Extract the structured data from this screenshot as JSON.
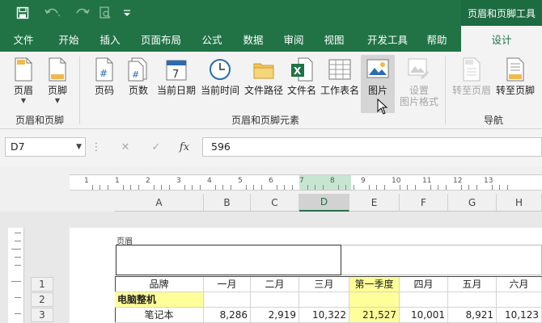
{
  "qat": {
    "save_icon": "save-icon",
    "undo_icon": "undo-icon",
    "redo_icon": "redo-icon",
    "preview_icon": "print-preview-icon",
    "customize_icon": "customize-qat-icon"
  },
  "context_tab_title": "页眉和页脚工具",
  "tabs": [
    {
      "label": "文件"
    },
    {
      "label": "开始"
    },
    {
      "label": "插入"
    },
    {
      "label": "页面布局"
    },
    {
      "label": "公式"
    },
    {
      "label": "数据"
    },
    {
      "label": "审阅"
    },
    {
      "label": "视图"
    },
    {
      "label": "开发工具"
    },
    {
      "label": "帮助"
    },
    {
      "label": "设计"
    }
  ],
  "ribbon": {
    "buttons": [
      {
        "label": "页眉",
        "icon": "header-icon"
      },
      {
        "label": "页脚",
        "icon": "footer-icon"
      },
      {
        "label": "页码",
        "icon": "page-number-icon"
      },
      {
        "label": "页数",
        "icon": "page-count-icon"
      },
      {
        "label": "当前日期",
        "icon": "calendar-icon"
      },
      {
        "label": "当前时间",
        "icon": "clock-icon"
      },
      {
        "label": "文件路径",
        "icon": "folder-icon"
      },
      {
        "label": "文件名",
        "icon": "excel-file-icon"
      },
      {
        "label": "工作表名",
        "icon": "sheet-icon"
      },
      {
        "label": "图片",
        "icon": "picture-icon"
      },
      {
        "label": "设置\n图片格式",
        "icon": "format-picture-icon"
      },
      {
        "label": "转至页眉",
        "icon": "goto-header-icon"
      },
      {
        "label": "转至页脚",
        "icon": "goto-footer-icon"
      }
    ],
    "groups": [
      {
        "label": "页眉和页脚"
      },
      {
        "label": "页眉和页脚元素"
      },
      {
        "label": "导航"
      }
    ]
  },
  "formula_bar": {
    "name_box": "D7",
    "cancel_icon": "cancel-icon",
    "enter_icon": "check-icon",
    "fx_label": "fx",
    "value": "596"
  },
  "ruler": {
    "numbers": [
      "1",
      "1",
      "2",
      "3",
      "4",
      "5",
      "6",
      "7",
      "8",
      "9",
      "10",
      "11",
      "12",
      "13"
    ]
  },
  "columns": [
    "A",
    "B",
    "C",
    "D",
    "E",
    "F",
    "G",
    "H"
  ],
  "active_column": "D",
  "page": {
    "header_label": "页眉"
  },
  "rows": [
    {
      "num": "1",
      "cells": [
        "品牌",
        "一月",
        "二月",
        "三月",
        "第一季度",
        "四月",
        "五月",
        "六月"
      ]
    },
    {
      "num": "2",
      "cells": [
        "电脑整机",
        "",
        "",
        "",
        "",
        "",
        "",
        ""
      ]
    },
    {
      "num": "3",
      "cells": [
        "笔记本",
        "8,286",
        "2,919",
        "10,322",
        "21,527",
        "10,001",
        "8,921",
        "10,123"
      ]
    }
  ],
  "colors": {
    "brand_green": "#217346",
    "highlight_yellow": "#ffff99"
  }
}
